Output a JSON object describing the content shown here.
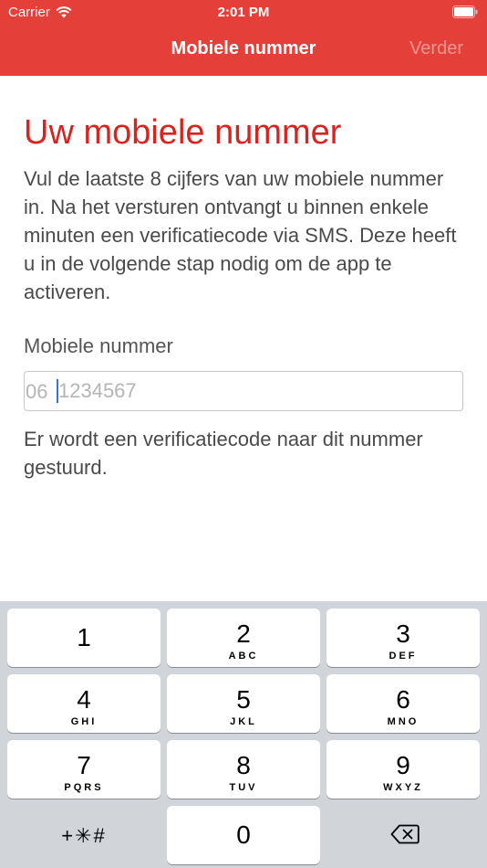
{
  "status_bar": {
    "carrier": "Carrier",
    "time": "2:01 PM"
  },
  "nav": {
    "title": "Mobiele nummer",
    "next": "Verder"
  },
  "main": {
    "title": "Uw mobiele nummer",
    "intro": "Vul de laatste 8 cijfers van uw mobiele nummer in. Na het versturen ontvangt u binnen enkele minuten een verificatiecode via SMS. Deze heeft u in de volgende stap nodig om de app te activeren.",
    "field_label": "Mobiele nummer",
    "phone_prefix": "06",
    "phone_placeholder": "1234567",
    "hint": "Er wordt een verificatiecode naar dit nummer gestuurd."
  },
  "keyboard": {
    "keys": [
      {
        "digit": "1",
        "letters": ""
      },
      {
        "digit": "2",
        "letters": "ABC"
      },
      {
        "digit": "3",
        "letters": "DEF"
      },
      {
        "digit": "4",
        "letters": "GHI"
      },
      {
        "digit": "5",
        "letters": "JKL"
      },
      {
        "digit": "6",
        "letters": "MNO"
      },
      {
        "digit": "7",
        "letters": "PQRS"
      },
      {
        "digit": "8",
        "letters": "TUV"
      },
      {
        "digit": "9",
        "letters": "WXYZ"
      }
    ],
    "symbols": "+✳#",
    "zero": "0",
    "backspace_icon": "backspace-icon"
  },
  "colors": {
    "header": "#e53f3a",
    "title": "#d8231f",
    "caret": "#3a6fd8",
    "keyboard_bg": "#d1d4d9"
  }
}
